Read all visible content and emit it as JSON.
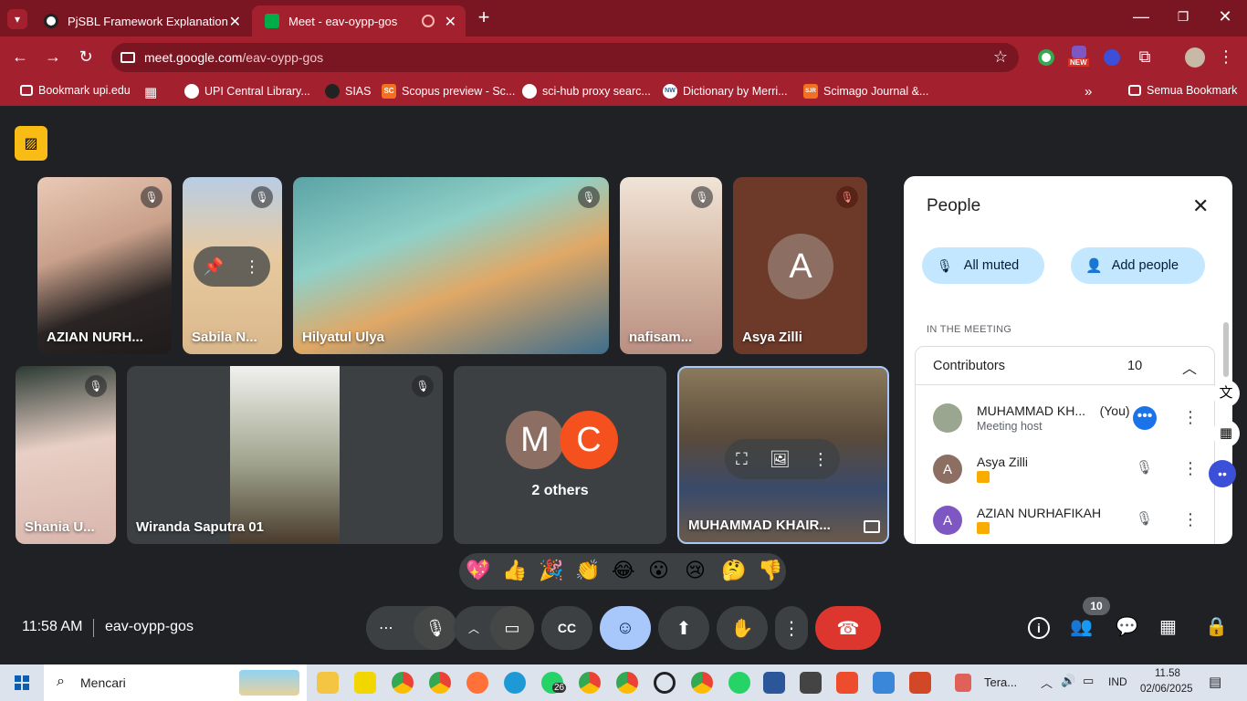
{
  "browser": {
    "tabs": [
      {
        "title": "PjSBL Framework Explanation"
      },
      {
        "title": "Meet - eav-oypp-gos"
      }
    ],
    "url_host": "meet.google.com",
    "url_path": "/eav-oypp-gos",
    "ext_badge": "NEW",
    "bookmarks": [
      "Bookmark upi.edu",
      "UPI Central Library...",
      "SIAS",
      "Scopus preview - Sc...",
      "sci-hub proxy searc...",
      "Dictionary by Merri...",
      "Scimago Journal &...",
      "Semua Bookmark"
    ],
    "bookmark_badges": [
      "SC",
      "NW",
      "SJR"
    ]
  },
  "meet": {
    "tiles": [
      {
        "name": "AZIAN NURH..."
      },
      {
        "name": "Sabila N..."
      },
      {
        "name": "Hilyatul Ulya"
      },
      {
        "name": "nafisam..."
      },
      {
        "name": "Asya Zilli",
        "initial": "A"
      },
      {
        "name": "Shania U..."
      },
      {
        "name": "Wiranda Saputra 01"
      },
      {
        "name": "2 others",
        "initials": [
          "M",
          "C"
        ]
      },
      {
        "name": "MUHAMMAD KHAIR..."
      }
    ],
    "people": {
      "title": "People",
      "all_muted": "All muted",
      "add_people": "Add people",
      "section": "IN THE MEETING",
      "group_label": "Contributors",
      "group_count": "10",
      "participants": [
        {
          "name": "MUHAMMAD KH...",
          "you": "(You)",
          "role": "Meeting host"
        },
        {
          "name": "Asya Zilli",
          "initial": "A"
        },
        {
          "name": "AZIAN NURHAFIKAH",
          "initial": "A"
        }
      ]
    },
    "reactions": [
      "💖",
      "👍",
      "🎉",
      "👏",
      "😂",
      "😮",
      "😢",
      "🤔",
      "👎"
    ],
    "time": "11:58 AM",
    "meeting_code": "eav-oypp-gos",
    "participant_count": "10",
    "colors": {
      "end_call": "#dc362e",
      "reaction_active": "#a8c7fa",
      "avatar_brown": "#8d6e63",
      "avatar_orange": "#f4511e",
      "avatar_purple": "#7e57c2"
    }
  },
  "taskbar": {
    "search": "Mencari",
    "whatsapp_badge": "26",
    "weather": "Tera...",
    "lang": "IND",
    "clock_time": "11.58",
    "clock_date": "02/06/2025"
  }
}
